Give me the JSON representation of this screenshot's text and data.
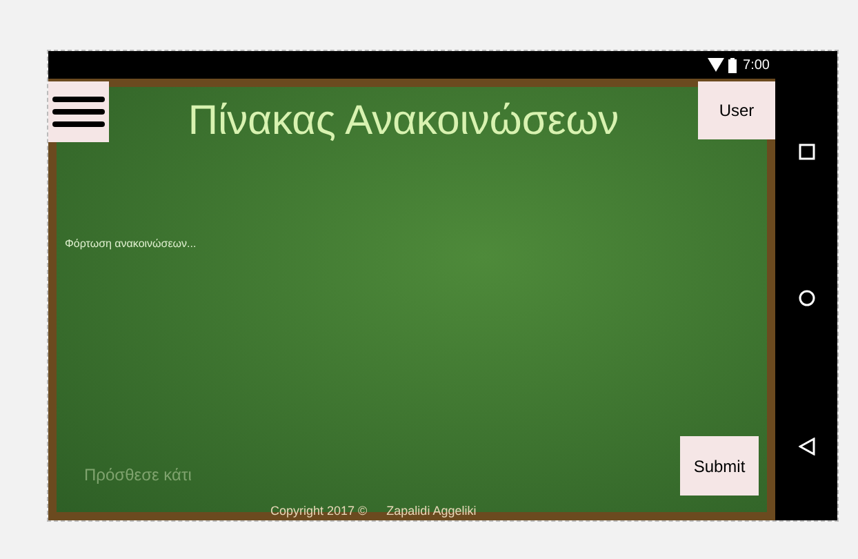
{
  "status_bar": {
    "time": "7:00"
  },
  "header": {
    "title": "Πίνακας Ανακοινώσεων",
    "user_button": "User"
  },
  "content": {
    "loading_text": "Φόρτωση ανακοινώσεων..."
  },
  "composer": {
    "placeholder": "Πρόσθεσε κάτι",
    "submit_button": "Submit"
  },
  "footer": {
    "copyright": "Copyright 2017 ©",
    "author": "Zapalidi Aggeliki"
  }
}
